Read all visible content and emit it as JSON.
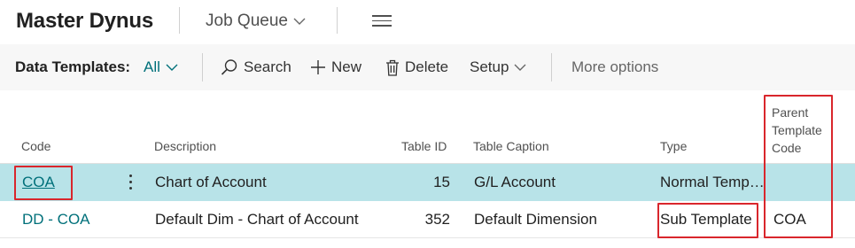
{
  "header": {
    "title": "Master Dynus",
    "nav_menu_label": "Job Queue",
    "chevron_icon": "chevron-down-icon",
    "menu_icon": "hamburger-icon"
  },
  "actionbar": {
    "label": "Data Templates:",
    "filter": "All",
    "search": "Search",
    "new": "New",
    "delete": "Delete",
    "setup": "Setup",
    "more": "More options"
  },
  "table": {
    "columns": {
      "code": "Code",
      "description": "Description",
      "table_id": "Table ID",
      "table_caption": "Table Caption",
      "type": "Type",
      "parent_line1": "Parent",
      "parent_line2": "Template",
      "parent_line3": "Code"
    },
    "rows": [
      {
        "code": "COA",
        "description": "Chart of Account",
        "table_id": "15",
        "table_caption": "G/L Account",
        "type": "Normal Temp…",
        "parent_code": ""
      },
      {
        "code": "DD - COA",
        "description": "Default Dim - Chart of Account",
        "table_id": "352",
        "table_caption": "Default Dimension",
        "type": "Sub Template",
        "parent_code": "COA"
      }
    ]
  },
  "colors": {
    "accent": "#00707a",
    "selected_row": "#b8e3e8",
    "highlight_box": "#d9262c"
  }
}
